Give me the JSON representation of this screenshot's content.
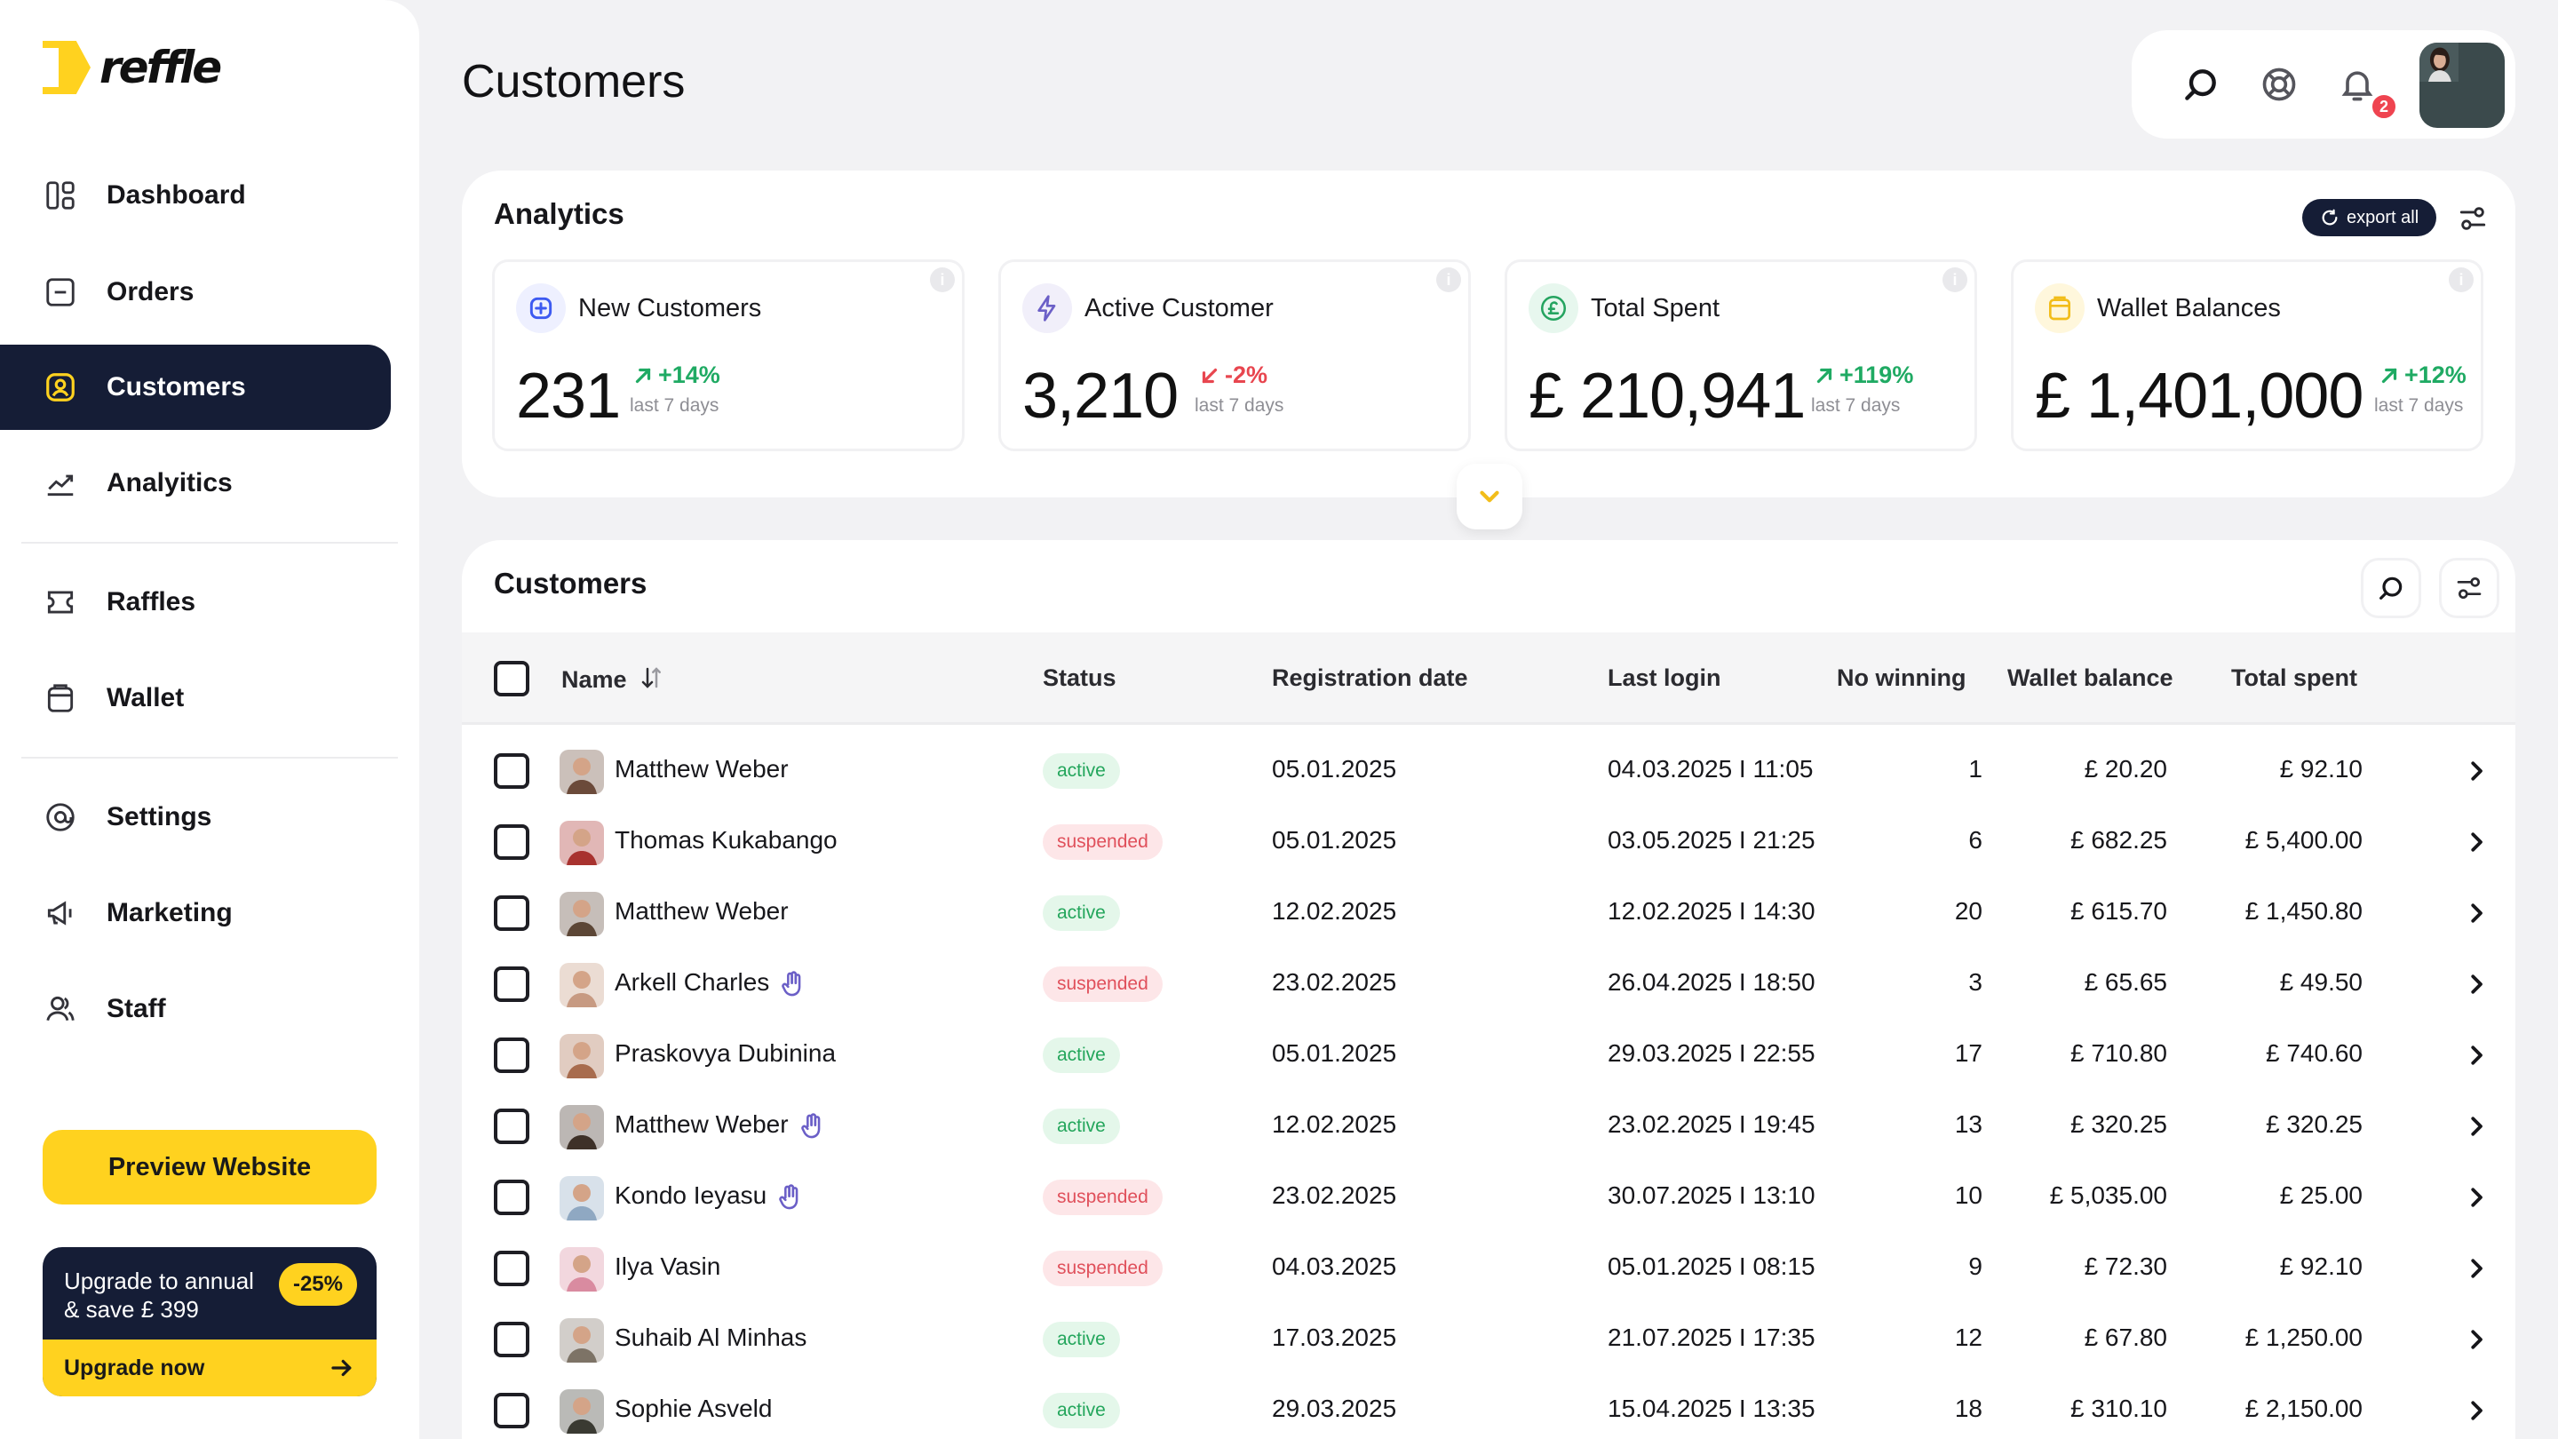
{
  "app": {
    "brand": "reffle"
  },
  "sidebar": {
    "items": [
      {
        "label": "Dashboard",
        "icon": "dashboard-icon"
      },
      {
        "label": "Orders",
        "icon": "orders-icon"
      },
      {
        "label": "Customers",
        "icon": "customers-icon",
        "active": true
      },
      {
        "label": "Analyitics",
        "icon": "analytics-icon"
      },
      {
        "label": "Raffles",
        "icon": "raffles-icon"
      },
      {
        "label": "Wallet",
        "icon": "wallet-icon"
      },
      {
        "label": "Settings",
        "icon": "settings-icon"
      },
      {
        "label": "Marketing",
        "icon": "megaphone-icon"
      },
      {
        "label": "Staff",
        "icon": "staff-icon"
      }
    ],
    "preview_label": "Preview Website",
    "upgrade": {
      "line1": "Upgrade to annual",
      "line2": "& save £ 399",
      "badge": "-25%",
      "cta": "Upgrade now"
    }
  },
  "header": {
    "title": "Customers",
    "notifications_count": "2"
  },
  "analytics": {
    "title": "Analytics",
    "export_label": "export all",
    "cards": [
      {
        "title": "New Customers",
        "value": "231",
        "delta": "+14%",
        "direction": "up",
        "period": "last 7 days",
        "icon": "plus-square-icon",
        "icon_bg": "#eef0ff",
        "icon_color": "#3d5af1"
      },
      {
        "title": "Active Customer",
        "value": "3,210",
        "delta": "-2%",
        "direction": "down",
        "period": "last 7 days",
        "icon": "lightning-icon",
        "icon_bg": "#f1effa",
        "icon_color": "#6b5fc7"
      },
      {
        "title": "Total Spent",
        "value": "£ 210,941",
        "delta": "+119%",
        "direction": "up",
        "period": "last 7 days",
        "icon": "pound-coin-icon",
        "icon_bg": "#e7f7ee",
        "icon_color": "#25a460"
      },
      {
        "title": "Wallet Balances",
        "value": "£ 1,401,000",
        "delta": "+12%",
        "direction": "up",
        "period": "last 7 days",
        "icon": "wallet-icon",
        "icon_bg": "#fff7dc",
        "icon_color": "#f2bd1a"
      }
    ]
  },
  "customers": {
    "title": "Customers",
    "columns": {
      "name": "Name",
      "status": "Status",
      "registration": "Registration date",
      "last_login": "Last login",
      "no_winning": "No winning",
      "wallet": "Wallet balance",
      "total": "Total spent"
    },
    "rows": [
      {
        "name": "Matthew Weber",
        "verified": false,
        "status": "active",
        "registration": "05.01.2025",
        "last_login": "04.03.2025 I 11:05",
        "no_winning": "1",
        "wallet": "£ 20.20",
        "total": "£ 92.10",
        "avatar_color": "#6b4a3a"
      },
      {
        "name": "Thomas Kukabango",
        "verified": false,
        "status": "suspended",
        "registration": "05.01.2025",
        "last_login": "03.05.2025 I 21:25",
        "no_winning": "6",
        "wallet": "£ 682.25",
        "total": "£ 5,400.00",
        "avatar_color": "#a8322f"
      },
      {
        "name": "Matthew Weber",
        "verified": false,
        "status": "active",
        "registration": "12.02.2025",
        "last_login": "12.02.2025 I 14:30",
        "no_winning": "20",
        "wallet": "£ 615.70",
        "total": "£ 1,450.80",
        "avatar_color": "#5c4636"
      },
      {
        "name": "Arkell Charles",
        "verified": true,
        "status": "suspended",
        "registration": "23.02.2025",
        "last_login": "26.04.2025 I 18:50",
        "no_winning": "3",
        "wallet": "£ 65.65",
        "total": "£ 49.50",
        "avatar_color": "#c79a82"
      },
      {
        "name": "Praskovya Dubinina",
        "verified": false,
        "status": "active",
        "registration": "05.01.2025",
        "last_login": "29.03.2025 I 22:55",
        "no_winning": "17",
        "wallet": "£ 710.80",
        "total": "£ 740.60",
        "avatar_color": "#a86c4e"
      },
      {
        "name": "Matthew Weber",
        "verified": true,
        "status": "active",
        "registration": "12.02.2025",
        "last_login": "23.02.2025 I 19:45",
        "no_winning": "13",
        "wallet": "£ 320.25",
        "total": "£ 320.25",
        "avatar_color": "#3e3128"
      },
      {
        "name": "Kondo Ieyasu",
        "verified": true,
        "status": "suspended",
        "registration": "23.02.2025",
        "last_login": "30.07.2025 I 13:10",
        "no_winning": "10",
        "wallet": "£ 5,035.00",
        "total": "£ 25.00",
        "avatar_color": "#8fa8c2"
      },
      {
        "name": "Ilya Vasin",
        "verified": false,
        "status": "suspended",
        "registration": "04.03.2025",
        "last_login": "05.01.2025 I 08:15",
        "no_winning": "9",
        "wallet": "£ 72.30",
        "total": "£ 92.10",
        "avatar_color": "#d98ba0"
      },
      {
        "name": "Suhaib Al Minhas",
        "verified": false,
        "status": "active",
        "registration": "17.03.2025",
        "last_login": "21.07.2025 I 17:35",
        "no_winning": "12",
        "wallet": "£ 67.80",
        "total": "£ 1,250.00",
        "avatar_color": "#7d7366"
      },
      {
        "name": "Sophie Asveld",
        "verified": false,
        "status": "active",
        "registration": "29.03.2025",
        "last_login": "15.04.2025 I 13:35",
        "no_winning": "18",
        "wallet": "£ 310.10",
        "total": "£ 2,150.00",
        "avatar_color": "#3a3a32"
      }
    ]
  }
}
